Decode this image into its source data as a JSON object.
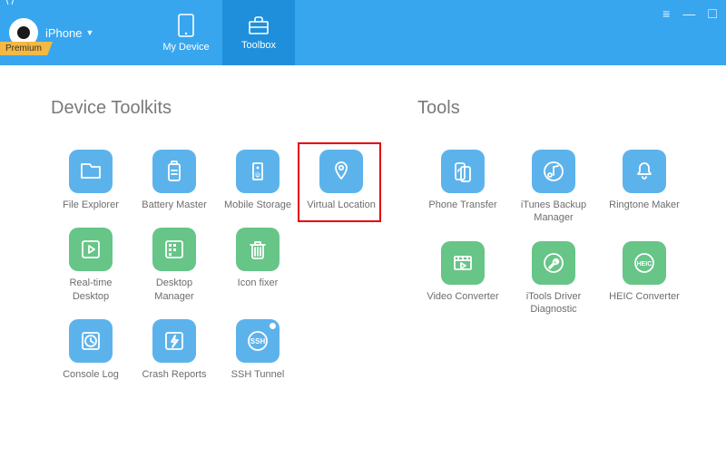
{
  "header": {
    "device": "iPhone",
    "premium": "Premium",
    "tabs": {
      "myDevice": "My Device",
      "toolbox": "Toolbox"
    }
  },
  "sections": {
    "deviceToolkits": "Device Toolkits",
    "tools": "Tools"
  },
  "toolkits": [
    {
      "key": "file-explorer",
      "label": "File Explorer",
      "color": "blue"
    },
    {
      "key": "battery-master",
      "label": "Battery Master",
      "color": "blue"
    },
    {
      "key": "mobile-storage",
      "label": "Mobile Storage",
      "color": "blue"
    },
    {
      "key": "virtual-location",
      "label": "Virtual Location",
      "color": "blue"
    },
    {
      "key": "realtime-desktop",
      "label": "Real-time Desktop",
      "color": "green"
    },
    {
      "key": "desktop-manager",
      "label": "Desktop Manager",
      "color": "green"
    },
    {
      "key": "icon-fixer",
      "label": "Icon fixer",
      "color": "green"
    },
    {
      "key": "console-log",
      "label": "Console Log",
      "color": "blue"
    },
    {
      "key": "crash-reports",
      "label": "Crash Reports",
      "color": "blue"
    },
    {
      "key": "ssh-tunnel",
      "label": "SSH Tunnel",
      "color": "blue"
    }
  ],
  "tools": [
    {
      "key": "phone-transfer",
      "label": "Phone Transfer",
      "color": "blue"
    },
    {
      "key": "itunes-backup",
      "label": "iTunes Backup Manager",
      "color": "blue"
    },
    {
      "key": "ringtone-maker",
      "label": "Ringtone Maker",
      "color": "blue"
    },
    {
      "key": "video-converter",
      "label": "Video Converter",
      "color": "green"
    },
    {
      "key": "itools-driver",
      "label": "iTools Driver Diagnostic",
      "color": "green"
    },
    {
      "key": "heic-converter",
      "label": "HEIC Converter",
      "color": "green"
    }
  ],
  "highlightKey": "virtual-location",
  "iconNames": {
    "file-explorer": "folder-icon",
    "battery-master": "battery-icon",
    "mobile-storage": "usb-icon",
    "virtual-location": "location-pin-icon",
    "realtime-desktop": "play-icon",
    "desktop-manager": "grid-icon",
    "icon-fixer": "trash-icon",
    "console-log": "clock-icon",
    "crash-reports": "lightning-icon",
    "ssh-tunnel": "ssh-icon",
    "phone-transfer": "phone-sync-icon",
    "itunes-backup": "music-note-icon",
    "ringtone-maker": "bell-icon",
    "video-converter": "film-icon",
    "itools-driver": "wrench-icon",
    "heic-converter": "heic-icon"
  }
}
